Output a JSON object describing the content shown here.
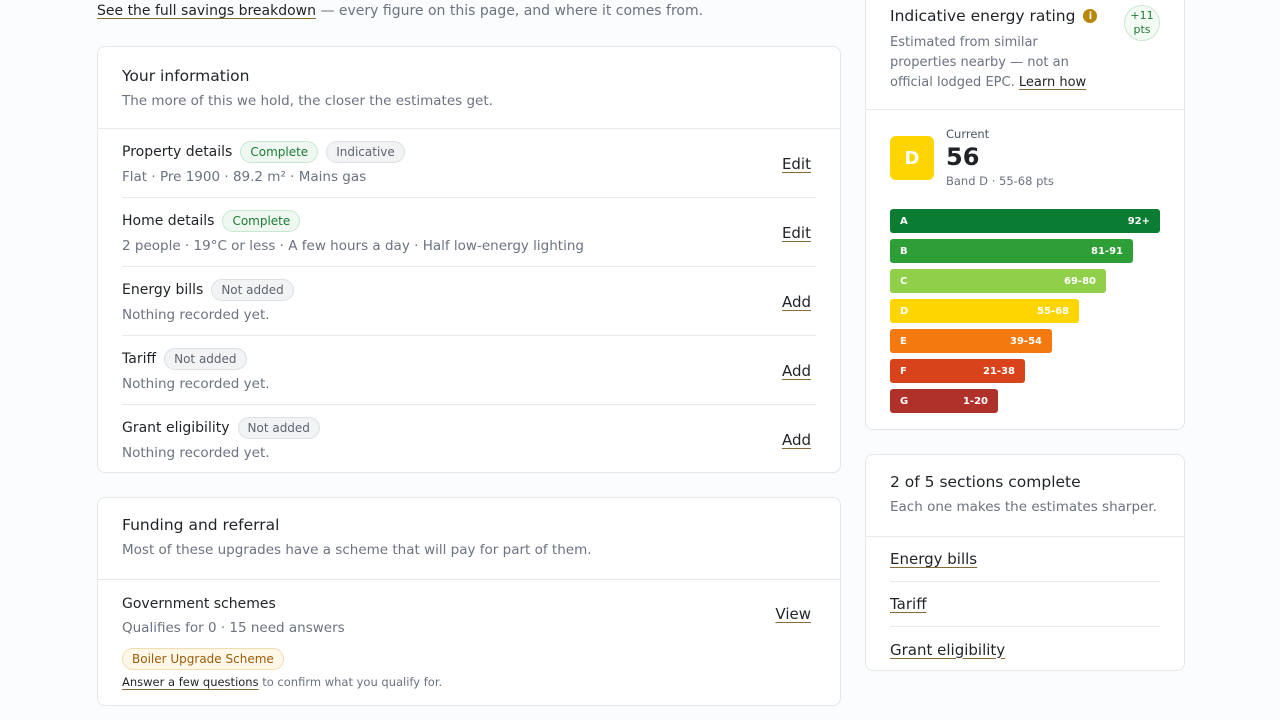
{
  "top_line": {
    "link": "See the full savings breakdown",
    "text": "— every figure on this page, and where it comes from."
  },
  "info": {
    "title": "Your information",
    "subtitle": "The more of this we hold, the closer the estimates get.",
    "rows": [
      {
        "label": "Property details",
        "badges": [
          "Complete",
          "Indicative"
        ],
        "detail": "Flat · Pre 1900 · 89.2 m² · Mains gas",
        "action": "Edit"
      },
      {
        "label": "Home details",
        "badges": [
          "Complete"
        ],
        "detail": "2 people · 19°C or less · A few hours a day · Half low-energy lighting",
        "action": "Edit"
      },
      {
        "label": "Energy bills",
        "badges": [
          "Not added"
        ],
        "detail": "Nothing recorded yet.",
        "action": "Add"
      },
      {
        "label": "Tariff",
        "badges": [
          "Not added"
        ],
        "detail": "Nothing recorded yet.",
        "action": "Add"
      },
      {
        "label": "Grant eligibility",
        "badges": [
          "Not added"
        ],
        "detail": "Nothing recorded yet.",
        "action": "Add"
      }
    ]
  },
  "funding": {
    "title": "Funding and referral",
    "subtitle": "Most of these upgrades have a scheme that will pay for part of them.",
    "gov_title": "Government schemes",
    "gov_detail": "Qualifies for 0 · 15 need answers",
    "gov_badge": "Boiler Upgrade Scheme",
    "gov_note_link": "Answer a few questions",
    "gov_note_text": "to confirm what you qualify for.",
    "gov_action": "View"
  },
  "rating": {
    "title": "Indicative energy rating",
    "info_icon": "info-icon",
    "desc": "Estimated from similar properties nearby — not an official lodged EPC.",
    "learn_link": "Learn how",
    "pts_top": "+11",
    "pts_bottom": "pts",
    "current_label": "Current",
    "current_band_letter": "D",
    "current_score": "56",
    "current_band_text": "Band D · 55-68 pts",
    "bands": [
      {
        "letter": "A",
        "range": "92+",
        "color": "#0a7d33"
      },
      {
        "letter": "B",
        "range": "81-91",
        "color": "#2e9e36"
      },
      {
        "letter": "C",
        "range": "69-80",
        "color": "#8fcf4a"
      },
      {
        "letter": "D",
        "range": "55-68",
        "color": "#ffd500"
      },
      {
        "letter": "E",
        "range": "39-54",
        "color": "#f47a10"
      },
      {
        "letter": "F",
        "range": "21-38",
        "color": "#d8431b"
      },
      {
        "letter": "G",
        "range": "1-20",
        "color": "#b0302a"
      }
    ]
  },
  "sections": {
    "title": "2 of 5 sections complete",
    "subtitle": "Each one makes the estimates sharper.",
    "items": [
      "Energy bills",
      "Tariff",
      "Grant eligibility"
    ]
  }
}
